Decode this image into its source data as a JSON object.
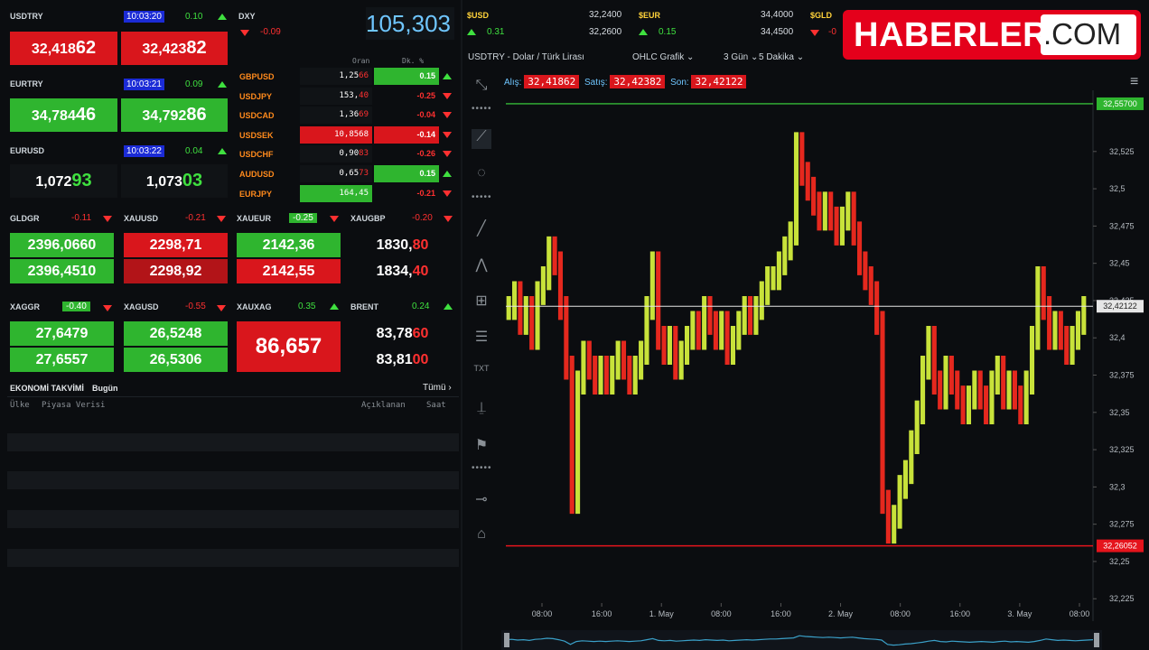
{
  "colors": {
    "up": "#3fe03f",
    "down": "#ff3030",
    "quote_red": "#d9161c",
    "quote_green": "#2fb52f",
    "time_badge": "#1b2bd6",
    "brand_red": "#e4001b"
  },
  "fx_quotes": [
    {
      "symbol": "USDTRY",
      "time": "10:03:20",
      "change": "0.10",
      "bid_main": "32,418",
      "bid_pip": "62",
      "ask_main": "32,423",
      "ask_pip": "82"
    },
    {
      "symbol": "EURTRY",
      "time": "10:03:21",
      "change": "0.09",
      "bid_main": "34,784",
      "bid_pip": "46",
      "ask_main": "34,792",
      "ask_pip": "86"
    },
    {
      "symbol": "EURUSD",
      "time": "10:03:22",
      "change": "0.04",
      "bid_main": "1,072",
      "bid_pip": "93",
      "ask_main": "1,073",
      "ask_pip": "03"
    }
  ],
  "dxy": {
    "symbol": "DXY",
    "change": "-0.09",
    "value": "105,303"
  },
  "fx_table": {
    "headers": {
      "rate": "Oran",
      "change": "Dk. %"
    },
    "rows": [
      {
        "symbol": "GBPUSD",
        "rate": "1,25",
        "rate_tail": "66",
        "change": "0.15",
        "dir": "up"
      },
      {
        "symbol": "USDJPY",
        "rate": "153,",
        "rate_tail": "40",
        "change": "-0.25",
        "dir": "down"
      },
      {
        "symbol": "USDCAD",
        "rate": "1,36",
        "rate_tail": "69",
        "change": "-0.04",
        "dir": "down"
      },
      {
        "symbol": "USDSEK",
        "rate": "10,8568",
        "rate_tail": "",
        "change": "-0.14",
        "dir": "down"
      },
      {
        "symbol": "USDCHF",
        "rate": "0,90",
        "rate_tail": "83",
        "change": "-0.26",
        "dir": "down"
      },
      {
        "symbol": "AUDUSD",
        "rate": "0,65",
        "rate_tail": "73",
        "change": "0.15",
        "dir": "up"
      },
      {
        "symbol": "EURJPY",
        "rate": "164,45",
        "rate_tail": "",
        "change": "-0.21",
        "dir": "down"
      }
    ]
  },
  "metals": [
    {
      "symbol": "GLDGR",
      "change": "-0.11",
      "bid": "2396,0660",
      "ask": "2396,4510"
    },
    {
      "symbol": "XAUUSD",
      "change": "-0.21",
      "bid": "2298,71",
      "ask": "2298,92"
    },
    {
      "symbol": "XAUEUR",
      "change": "-0.25",
      "bid": "2142,36",
      "ask": "2142,55"
    },
    {
      "symbol": "XAUGBP",
      "change": "-0.20",
      "bid": "1830,",
      "bid_tail": "80",
      "ask": "1834,",
      "ask_tail": "40"
    }
  ],
  "commodities": [
    {
      "symbol": "XAGGR",
      "change": "-0.40",
      "bid": "27,6479",
      "ask": "27,6557"
    },
    {
      "symbol": "XAGUSD",
      "change": "-0.55",
      "bid": "26,5248",
      "ask": "26,5306"
    },
    {
      "symbol": "XAUXAG",
      "change": "0.35",
      "value": "86,657"
    },
    {
      "symbol": "BRENT",
      "change": "0.24",
      "bid": "83,78",
      "bid_tail": "60",
      "ask": "83,81",
      "ask_tail": "00"
    }
  ],
  "calendar": {
    "title": "EKONOMİ TAKVİMİ",
    "subtitle": "Bugün",
    "all_link": "Tümü ›",
    "col_country": "Ülke",
    "col_data": "Piyasa Verisi",
    "col_announced": "Açıklanan",
    "col_time": "Saat"
  },
  "top_tickers": [
    {
      "symbol": "$USD",
      "change": "0.31",
      "bid": "32,2400",
      "ask": "32,2600"
    },
    {
      "symbol": "$EUR",
      "change": "0.15",
      "bid": "34,4000",
      "ask": "34,4500"
    },
    {
      "symbol": "$GLD",
      "change": "-0"
    }
  ],
  "brand": {
    "name": "HABERLER",
    "suffix": ".COM"
  },
  "chart_toolbar": {
    "instrument": "USDTRY - Dolar / Türk Lirası",
    "chart_type": "OHLC Grafik",
    "range": "3 Gün",
    "interval": "5 Dakika"
  },
  "chart_quote": {
    "bid_label": "Alış:",
    "bid": "32,41862",
    "ask_label": "Satış:",
    "ask": "32,42382",
    "last_label": "Son:",
    "last": "32,42122"
  },
  "chart_data": {
    "type": "line",
    "title": "USDTRY - Dolar / Türk Lirası",
    "x_ticks": [
      "08:00",
      "16:00",
      "1. May",
      "08:00",
      "16:00",
      "2. May",
      "08:00",
      "16:00",
      "3. May",
      "08:00"
    ],
    "y_ticks": [
      "32,525",
      "32,5",
      "32,475",
      "32,45",
      "32,425",
      "32,4",
      "32,375",
      "32,35",
      "32,325",
      "32,3",
      "32,275",
      "32,25",
      "32,225"
    ],
    "ylim": [
      32.21,
      32.56
    ],
    "levels": {
      "high": "32,55700",
      "low": "32,26052",
      "last": "32,42122",
      "high_value": 32.557,
      "low_value": 32.2605,
      "last_value": 32.4212
    },
    "series": [
      {
        "values": [
          32.42,
          32.43,
          32.41,
          32.42,
          32.4,
          32.43,
          32.44,
          32.46,
          32.45,
          32.42,
          32.38,
          32.29,
          32.37,
          32.39,
          32.38,
          32.37,
          32.38,
          32.37,
          32.38,
          32.39,
          32.38,
          32.37,
          32.38,
          32.39,
          32.42,
          32.45,
          32.4,
          32.39,
          32.4,
          32.38,
          32.39,
          32.4,
          32.41,
          32.4,
          32.42,
          32.41,
          32.4,
          32.41,
          32.39,
          32.4,
          32.41,
          32.42,
          32.41,
          32.42,
          32.43,
          32.44,
          32.44,
          32.45,
          32.46,
          32.47,
          32.53,
          32.51,
          32.5,
          32.49,
          32.48,
          32.49,
          32.48,
          32.47,
          32.48,
          32.49,
          32.47,
          32.45,
          32.44,
          32.43,
          32.41,
          32.29,
          32.27,
          32.28,
          32.3,
          32.31,
          32.33,
          32.35,
          32.38,
          32.4,
          32.37,
          32.36,
          32.38,
          32.37,
          32.36,
          32.35,
          32.36,
          32.37,
          32.36,
          32.35,
          32.37,
          32.38,
          32.36,
          32.37,
          32.36,
          32.35,
          32.37,
          32.4,
          32.44,
          32.42,
          32.4,
          32.41,
          32.4,
          32.39,
          32.4,
          32.41,
          32.42
        ]
      }
    ]
  }
}
